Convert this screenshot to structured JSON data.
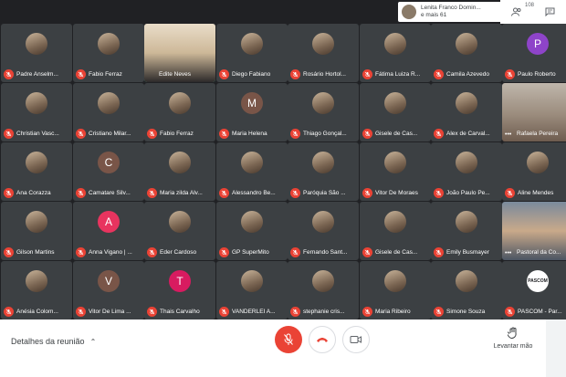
{
  "top_bar": {
    "presenter_name": "Lenita Franco Domin...",
    "presenter_more": "e mais 61",
    "participants_count": "108",
    "people_icon": "people-icon",
    "chat_icon": "chat-icon"
  },
  "tiles": [
    {
      "name": "Padre Anselm...",
      "kind": "photo"
    },
    {
      "name": "Fabio Ferraz",
      "kind": "photo"
    },
    {
      "name": "Edite Neves",
      "kind": "video",
      "active": true
    },
    {
      "name": "Diego Fabiano",
      "kind": "photo"
    },
    {
      "name": "Rosário Hortol...",
      "kind": "photo"
    },
    {
      "name": "Fátima Luiza R...",
      "kind": "photo"
    },
    {
      "name": "Camila Azevedo",
      "kind": "photo"
    },
    {
      "name": "Paulo Roberto",
      "kind": "letter",
      "letter": "P",
      "color": "#8e44c9"
    },
    {
      "name": "Christian Vasc...",
      "kind": "photo"
    },
    {
      "name": "Cristiano Milar...",
      "kind": "photo"
    },
    {
      "name": "Fabio Ferraz",
      "kind": "photo"
    },
    {
      "name": "Maria Helena",
      "kind": "letter",
      "letter": "M",
      "color": "#795548"
    },
    {
      "name": "Thiago Gonçal...",
      "kind": "photo"
    },
    {
      "name": "Gisele de Cas...",
      "kind": "photo"
    },
    {
      "name": "Alex de Carval...",
      "kind": "photo"
    },
    {
      "name": "Rafaela Pereira",
      "kind": "video"
    },
    {
      "name": "Ana Corazza",
      "kind": "photo"
    },
    {
      "name": "Camatare Silv...",
      "kind": "letter",
      "letter": "C",
      "color": "#795548"
    },
    {
      "name": "Maria zilda Alv...",
      "kind": "photo"
    },
    {
      "name": "Alessandro Be...",
      "kind": "photo"
    },
    {
      "name": "Paróquia São ...",
      "kind": "photo"
    },
    {
      "name": "Vitor De Moraes",
      "kind": "photo"
    },
    {
      "name": "João Paulo Pe...",
      "kind": "photo"
    },
    {
      "name": "Aline Mendes",
      "kind": "photo"
    },
    {
      "name": "Gilson Martins",
      "kind": "photo"
    },
    {
      "name": "Anna Vigano | ...",
      "kind": "letter",
      "letter": "A",
      "color": "#e8345f"
    },
    {
      "name": "Eder Cardoso",
      "kind": "photo"
    },
    {
      "name": "GP SuperMito",
      "kind": "photo"
    },
    {
      "name": "Fernando Sant...",
      "kind": "photo"
    },
    {
      "name": "Gisele de Cas...",
      "kind": "photo"
    },
    {
      "name": "Emily Busmayer",
      "kind": "photo"
    },
    {
      "name": "Pastoral da Co...",
      "kind": "video"
    },
    {
      "name": "Anésia Colom...",
      "kind": "photo"
    },
    {
      "name": "Vitor De Lima ...",
      "kind": "letter",
      "letter": "V",
      "color": "#795548"
    },
    {
      "name": "Thais Carvalho",
      "kind": "letter",
      "letter": "T",
      "color": "#d81b60"
    },
    {
      "name": "VANDERLEI A...",
      "kind": "photo"
    },
    {
      "name": "stephanie cris...",
      "kind": "photo"
    },
    {
      "name": "Maria Ribeiro",
      "kind": "photo"
    },
    {
      "name": "Simone Souza",
      "kind": "photo"
    },
    {
      "name": "PASCOM - Par...",
      "kind": "logo",
      "logo_text": "PASCOM"
    }
  ],
  "bottom_bar": {
    "meeting_details_label": "Detalhes da reunião",
    "raise_hand_label": "Levantar mão"
  }
}
